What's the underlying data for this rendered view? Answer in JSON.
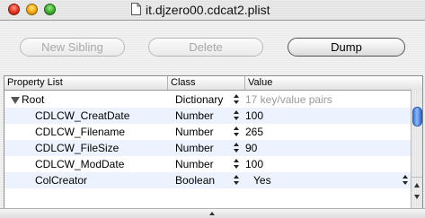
{
  "window": {
    "title": "it.djzero00.cdcat2.plist"
  },
  "toolbar": {
    "new_sibling_label": "New Sibling",
    "delete_label": "Delete",
    "dump_label": "Dump"
  },
  "table": {
    "columns": [
      "Property List",
      "Class",
      "Value"
    ],
    "rows": [
      {
        "key": "Root",
        "class": "Dictionary",
        "value": "17 key/value pairs"
      },
      {
        "key": "CDLCW_CreatDate",
        "class": "Number",
        "value": "100"
      },
      {
        "key": "CDLCW_Filename",
        "class": "Number",
        "value": "265"
      },
      {
        "key": "CDLCW_FileSize",
        "class": "Number",
        "value": "90"
      },
      {
        "key": "CDLCW_ModDate",
        "class": "Number",
        "value": "100"
      },
      {
        "key": "ColCreator",
        "class": "Boolean",
        "value": "Yes"
      }
    ]
  },
  "icons": {
    "window_controls": [
      "close-icon",
      "minimize-icon",
      "zoom-icon"
    ],
    "document": "document-icon",
    "disclosure": "disclosure-triangle-icon",
    "stepper": "stepper-arrows-icon",
    "splitter": "chevron-up-icon"
  },
  "colors": {
    "alt_row": "#edf3fe",
    "scroll_thumb": "#3c7ae3",
    "muted_value": "#999999"
  }
}
